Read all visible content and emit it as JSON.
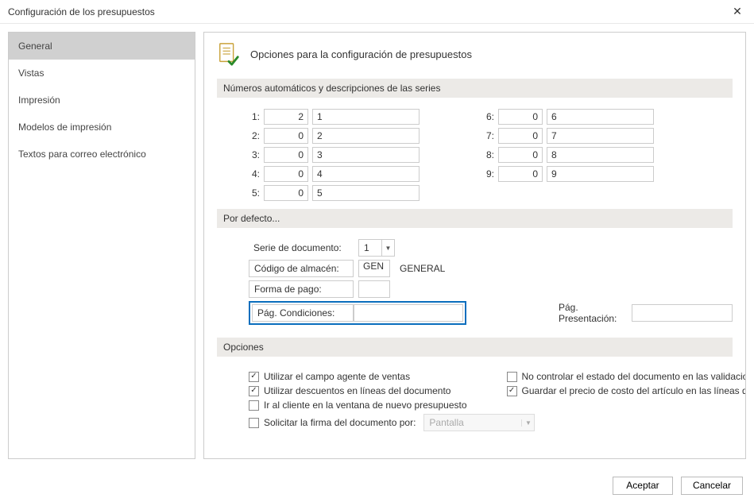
{
  "window": {
    "title": "Configuración de los presupuestos"
  },
  "sidebar": {
    "items": [
      {
        "label": "General",
        "selected": true
      },
      {
        "label": "Vistas",
        "selected": false
      },
      {
        "label": "Impresión",
        "selected": false
      },
      {
        "label": "Modelos de impresión",
        "selected": false
      },
      {
        "label": "Textos para correo electrónico",
        "selected": false
      }
    ]
  },
  "main": {
    "title": "Opciones para la configuración de presupuestos",
    "series_section": {
      "title": "Números automáticos y descripciones de las series",
      "rows": [
        {
          "label": "1:",
          "num": "2",
          "desc": "1"
        },
        {
          "label": "2:",
          "num": "0",
          "desc": "2"
        },
        {
          "label": "3:",
          "num": "0",
          "desc": "3"
        },
        {
          "label": "4:",
          "num": "0",
          "desc": "4"
        },
        {
          "label": "5:",
          "num": "0",
          "desc": "5"
        },
        {
          "label": "6:",
          "num": "0",
          "desc": "6"
        },
        {
          "label": "7:",
          "num": "0",
          "desc": "7"
        },
        {
          "label": "8:",
          "num": "0",
          "desc": "8"
        },
        {
          "label": "9:",
          "num": "0",
          "desc": "9"
        }
      ]
    },
    "defaults_section": {
      "title": "Por defecto...",
      "serie_label": "Serie de documento:",
      "serie_value": "1",
      "almacen_label": "Código de almacén:",
      "almacen_code": "GEN",
      "almacen_name": "GENERAL",
      "forma_pago_label": "Forma de pago:",
      "forma_pago_value": "",
      "cond_label": "Pág. Condiciones:",
      "cond_value": "",
      "pres_label": "Pág. Presentación:",
      "pres_value": ""
    },
    "options_section": {
      "title": "Opciones",
      "left": [
        {
          "checked": true,
          "label": "Utilizar el campo agente de ventas"
        },
        {
          "checked": true,
          "label": "Utilizar descuentos en líneas del documento"
        },
        {
          "checked": false,
          "label": "Ir al cliente en la ventana de nuevo presupuesto"
        }
      ],
      "right": [
        {
          "checked": false,
          "label": "No controlar el estado del documento en las validaciones"
        },
        {
          "checked": true,
          "label": "Guardar el precio de costo del artículo en las líneas de detalle"
        }
      ],
      "signature": {
        "checked": false,
        "label": "Solicitar la firma del documento por:",
        "value": "Pantalla"
      }
    }
  },
  "footer": {
    "ok": "Aceptar",
    "cancel": "Cancelar"
  }
}
